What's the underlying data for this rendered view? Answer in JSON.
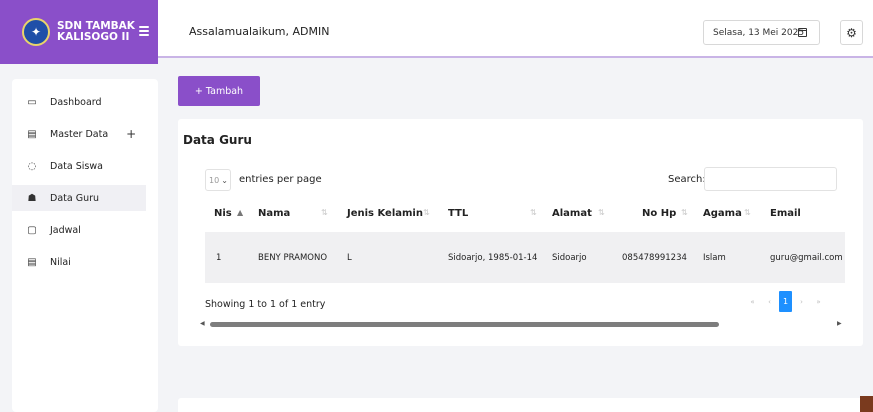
{
  "brand": {
    "line1": "SDN TAMBAK",
    "line2": "KALISOGO II",
    "logo_icon": "tut-wuri-handayani-logo"
  },
  "header": {
    "greeting": "Assalamualaikum, ADMIN",
    "date": "Selasa, 13 Mei 2025"
  },
  "sidebar": {
    "items": [
      {
        "label": "Dashboard",
        "icon": "monitor-icon"
      },
      {
        "label": "Master Data",
        "icon": "document-icon"
      },
      {
        "label": "Data Siswa",
        "icon": "circle-icon"
      },
      {
        "label": "Data Guru",
        "icon": "users-icon"
      },
      {
        "label": "Jadwal",
        "icon": "calendar-icon"
      },
      {
        "label": "Nilai",
        "icon": "document-icon"
      }
    ],
    "active": "Data Guru"
  },
  "main": {
    "add_button": "+ Tambah",
    "card_title": "Data Guru",
    "entries_value": "10",
    "entries_label": "entries per page",
    "search_label": "Search:",
    "search_value": "",
    "columns": [
      "Nis",
      "Nama",
      "Jenis Kelamin",
      "TTL",
      "Alamat",
      "No Hp",
      "Agama",
      "Email"
    ],
    "rows": [
      [
        "1",
        "BENY PRAMONO",
        "L",
        "Sidoarjo, 1985-01-14",
        "Sidoarjo",
        "085478991234",
        "Islam",
        "guru@gmail.com"
      ]
    ],
    "showing": "Showing 1 to 1 of 1 entry",
    "pagination": {
      "first": "«",
      "prev": "‹",
      "current": "1",
      "next": "›",
      "last": "»"
    }
  },
  "colors": {
    "accent": "#8a4fc9",
    "page_active": "#1e90ff",
    "row_bg": "#f0f0f2"
  }
}
